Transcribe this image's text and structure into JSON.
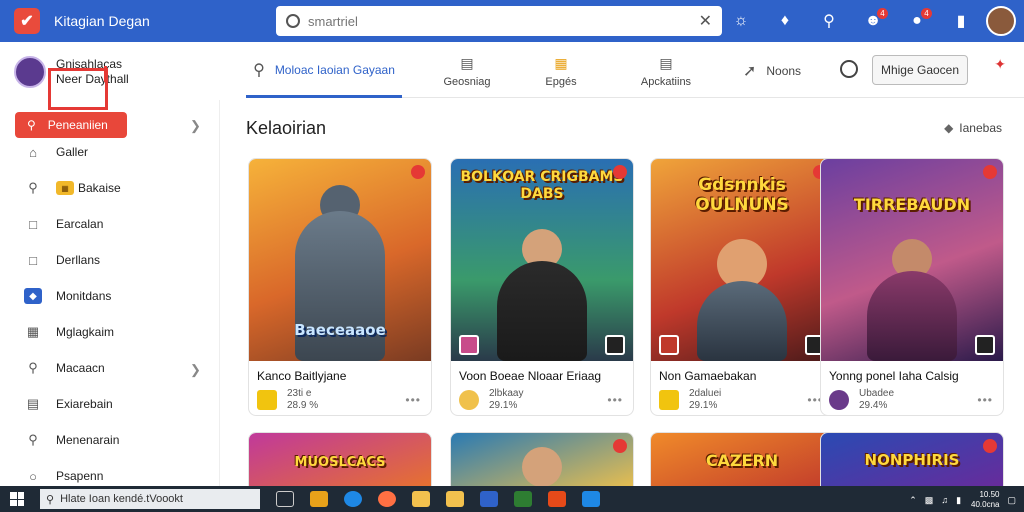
{
  "app": {
    "title": "Kitagian Degan",
    "logo_glyph": "✔"
  },
  "search": {
    "value": "",
    "placeholder": "smartriel",
    "clear_glyph": "✕"
  },
  "topbar": {
    "badges": [
      "4",
      "4"
    ]
  },
  "profile": {
    "line1": "Gnisahlacas",
    "line2": "Neer Daythall"
  },
  "tabs": [
    {
      "label": "Moloac Iaoian Gayaan"
    },
    {
      "label": "Geosniag"
    },
    {
      "label": "Epgés"
    },
    {
      "label": "Apckatiins"
    },
    {
      "label": "Noons"
    }
  ],
  "tab_button": {
    "label": "Mhige Gaocen"
  },
  "sidebar": {
    "primary": {
      "label": "Peneaniien"
    },
    "items": [
      {
        "label": "Galler"
      },
      {
        "label": "Bakaise"
      },
      {
        "label": "Earcalan"
      },
      {
        "label": "Derllans"
      },
      {
        "label": "Monitdans"
      },
      {
        "label": "Mglagkaim"
      },
      {
        "label": "Macaacn"
      },
      {
        "label": "Exiarebain"
      },
      {
        "label": "Menenarain"
      },
      {
        "label": "Psapenn"
      }
    ]
  },
  "section": {
    "title": "Kelaoirian",
    "link": "Ianebas"
  },
  "cards": [
    {
      "name": "Kanco Baitlyjane",
      "line1": "23ti e",
      "line2": "28.9 %",
      "logo": "Baeceaaoe",
      "dots": "•••"
    },
    {
      "name": "Voon Boeae Nloaar Eriaag",
      "line1": "2lbkaay",
      "line2": "29.1%",
      "logo": "BOLKOAR CRIGBAMS DABS",
      "dots": "•••"
    },
    {
      "name": "Non Gamaebakan",
      "line1": "2daluei",
      "line2": "29.1%",
      "logo": "Gdsnnkis OULNUNS",
      "dots": "•••"
    },
    {
      "name": "Yonng ponel Iaha Calsig",
      "line1": "Ubadee",
      "line2": "29.4%",
      "logo": "TIRREBAUDN",
      "dots": "•••"
    },
    {
      "name": "",
      "line1": "",
      "line2": "",
      "logo": "MUOSLCACS",
      "dots": ""
    },
    {
      "name": "",
      "line1": "",
      "line2": "",
      "logo": "",
      "dots": ""
    },
    {
      "name": "",
      "line1": "",
      "line2": "",
      "logo": "CAZERN",
      "dots": ""
    },
    {
      "name": "",
      "line1": "",
      "line2": "",
      "logo": "NONPHIRIS",
      "dots": ""
    }
  ],
  "taskbar": {
    "search_text": "Hlate Ioan kendé.tVoookt",
    "clock_line1": "10.50",
    "clock_line2": "40.0cna"
  }
}
